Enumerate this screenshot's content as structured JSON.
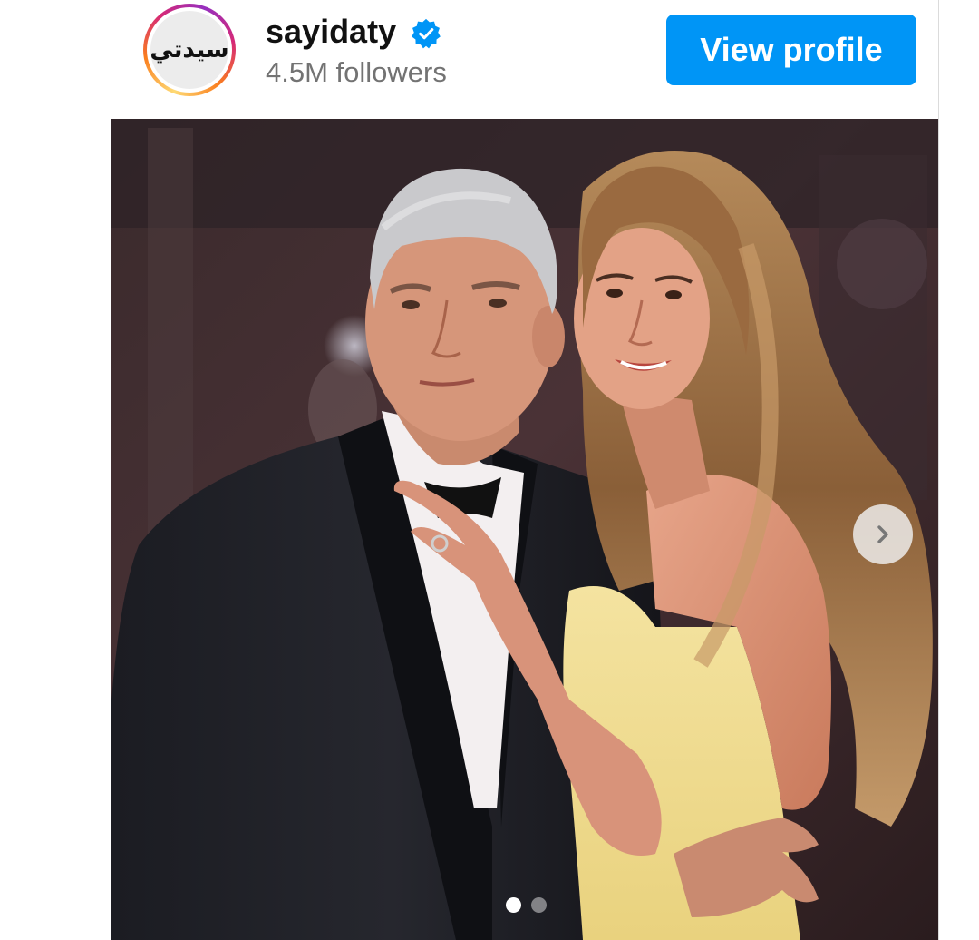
{
  "post": {
    "account": {
      "avatar_text": "سيدتي",
      "username": "sayidaty",
      "verified": true,
      "followers": "4.5M followers"
    },
    "view_profile_label": "View profile",
    "carousel": {
      "total_slides": 2,
      "active_slide": 1
    }
  },
  "colors": {
    "primary_button": "#0095f6",
    "verified_badge": "#0095f6",
    "secondary_text": "#737373"
  },
  "icons": {
    "verified": "verified-badge-icon",
    "next": "chevron-right-icon"
  }
}
